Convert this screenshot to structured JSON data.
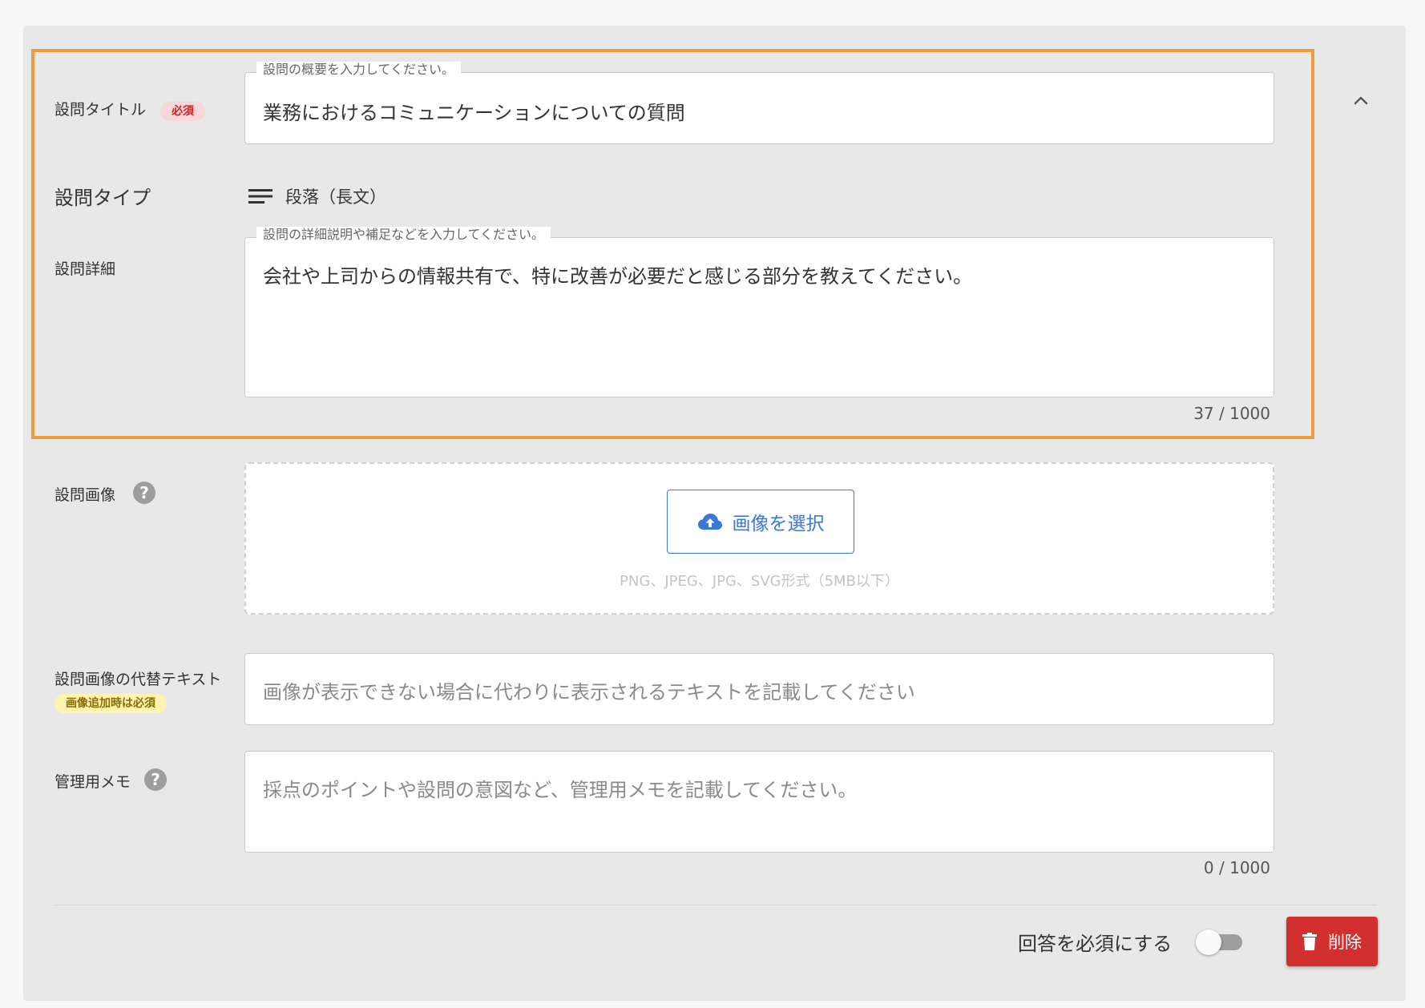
{
  "question_title": {
    "label": "設問タイトル",
    "badge": "必須",
    "float_label": "設問の概要を入力してください。",
    "value": "業務におけるコミュニケーションについての質問"
  },
  "question_type": {
    "label": "設問タイプ",
    "value": "段落（長文）",
    "icon": "paragraph-icon"
  },
  "question_detail": {
    "label": "設問詳細",
    "float_label": "設問の詳細説明や補足などを入力してください。",
    "value": "会社や上司からの情報共有で、特に改善が必要だと感じる部分を教えてください。",
    "counter": "37 / 1000"
  },
  "question_image": {
    "label": "設問画像",
    "help_icon": "?",
    "button_label": "画像を選択",
    "hint": "PNG、JPEG、JPG、SVG形式（5MB以下）"
  },
  "alt_text": {
    "label": "設問画像の代替テキスト",
    "badge": "画像追加時は必須",
    "placeholder": "画像が表示できない場合に代わりに表示されるテキストを記載してください"
  },
  "admin_memo": {
    "label": "管理用メモ",
    "help_icon": "?",
    "placeholder": "採点のポイントや設問の意図など、管理用メモを記載してください。",
    "counter": "0 / 1000"
  },
  "footer": {
    "required_toggle_label": "回答を必須にする",
    "required_toggle_on": false,
    "delete_label": "削除"
  },
  "colors": {
    "highlight": "#f19a3e",
    "primary": "#3b78d8",
    "danger": "#d32f2f"
  }
}
